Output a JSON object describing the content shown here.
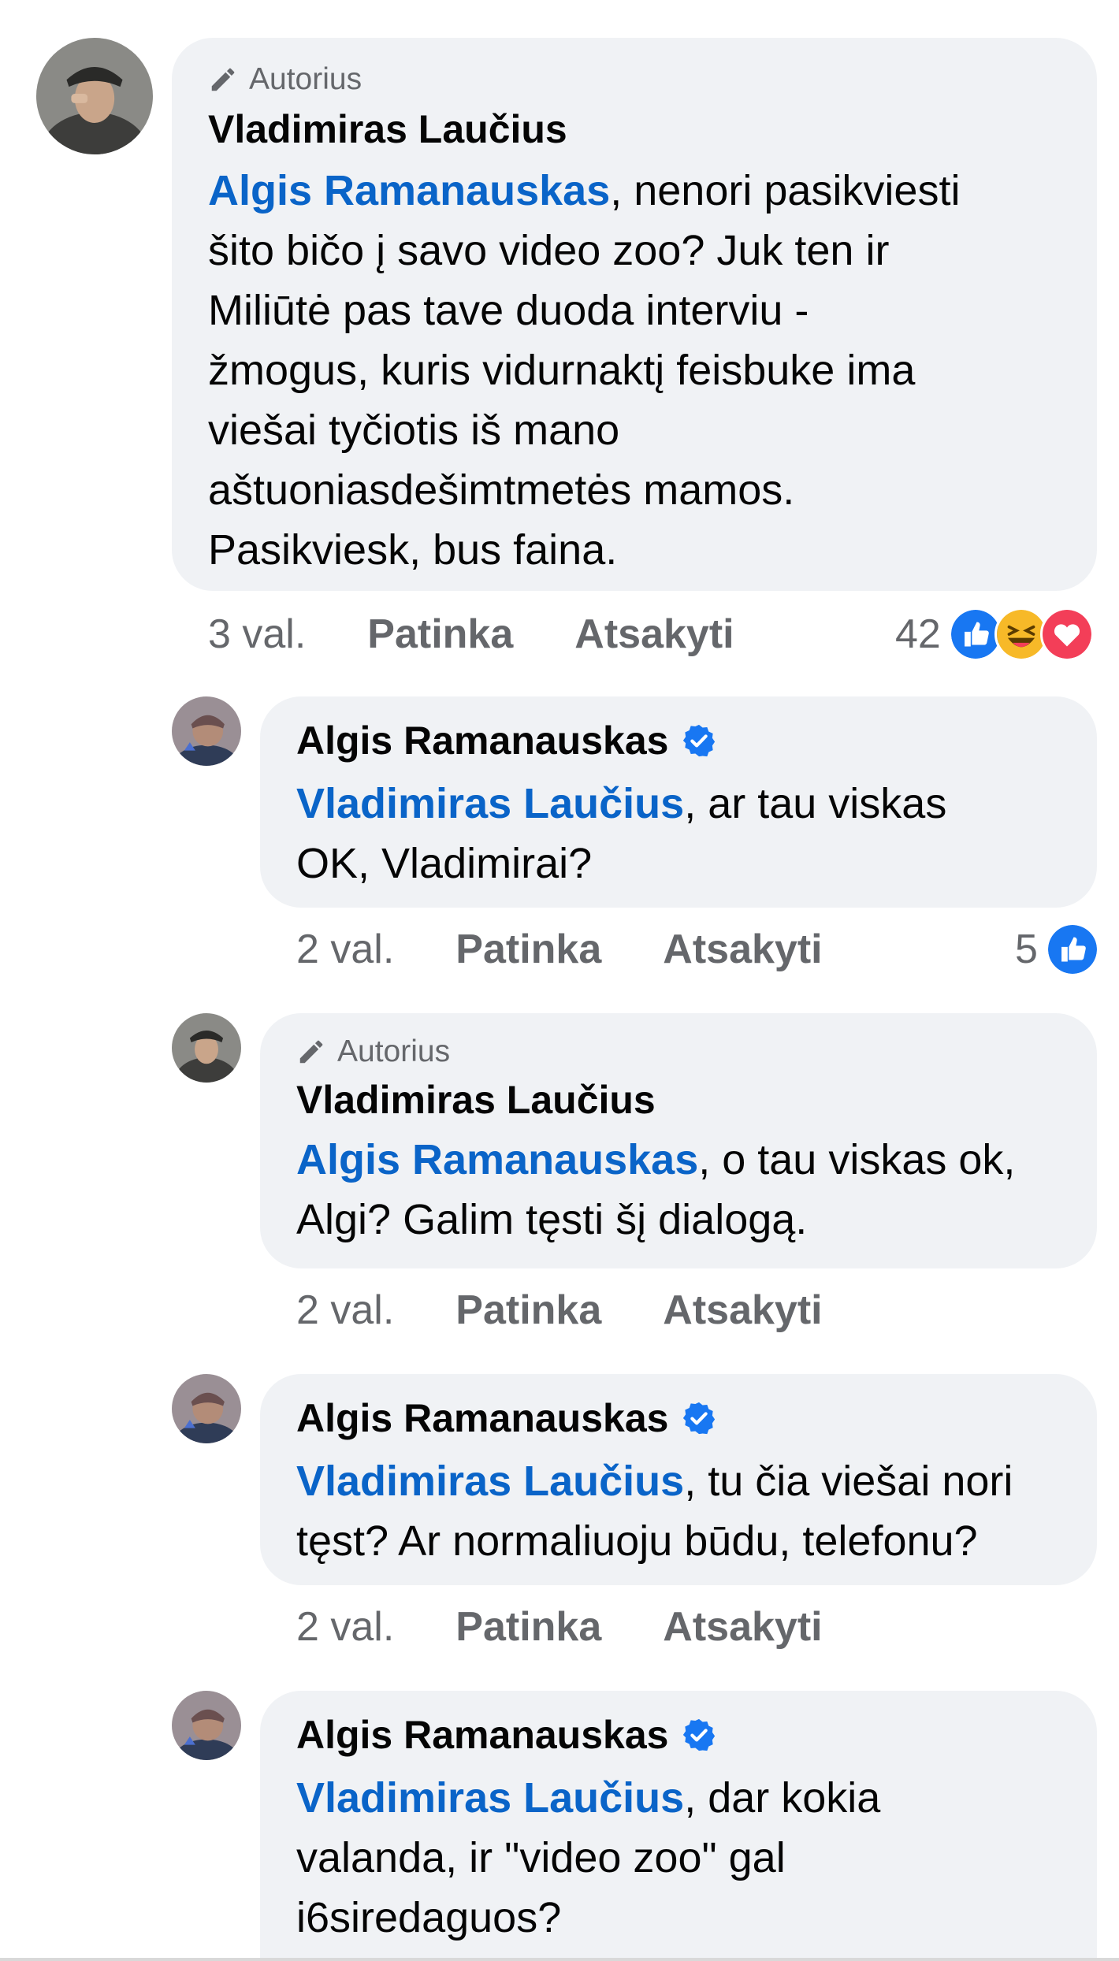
{
  "comments": [
    {
      "author_badge": "Autorius",
      "name": "Vladimiras Laučius",
      "verified": false,
      "mention": "Algis Ramanauskas",
      "lines": [
        ", nenori pasikviesti",
        "šito bičo į savo video zoo? Juk ten ir",
        "Miliūtė pas tave duoda interviu -",
        "žmogus, kuris vidurnaktį feisbuke ima",
        "viešai tyčiotis iš mano",
        "aštuoniasdešimtmetės mamos.",
        "Pasikviesk, bus faina."
      ],
      "time": "3 val.",
      "like_label": "Patinka",
      "reply_label": "Atsakyti",
      "reaction_count": "42",
      "reactions": [
        "like-icon",
        "haha-icon",
        "love-icon"
      ]
    },
    {
      "author_badge": "",
      "name": "Algis Ramanauskas",
      "verified": true,
      "mention": "Vladimiras Laučius",
      "lines": [
        ", ar tau viskas",
        "OK, Vladimirai?"
      ],
      "time": "2 val.",
      "like_label": "Patinka",
      "reply_label": "Atsakyti",
      "reaction_count": "5",
      "reactions": [
        "like-icon"
      ]
    },
    {
      "author_badge": "Autorius",
      "name": "Vladimiras Laučius",
      "verified": false,
      "mention": "Algis Ramanauskas",
      "lines": [
        ", o tau viskas ok,",
        "Algi? Galim tęsti šį dialogą."
      ],
      "time": "2 val.",
      "like_label": "Patinka",
      "reply_label": "Atsakyti",
      "reaction_count": "",
      "reactions": []
    },
    {
      "author_badge": "",
      "name": "Algis Ramanauskas",
      "verified": true,
      "mention": "Vladimiras Laučius",
      "lines": [
        ", tu čia viešai nori",
        "tęst? Ar normaliuoju būdu, telefonu?"
      ],
      "time": "2 val.",
      "like_label": "Patinka",
      "reply_label": "Atsakyti",
      "reaction_count": "",
      "reactions": []
    },
    {
      "author_badge": "",
      "name": "Algis Ramanauskas",
      "verified": true,
      "mention": "Vladimiras Laučius",
      "lines": [
        ", dar kokia",
        "valanda, ir \"video zoo\" gal",
        "i6siredaguos?"
      ],
      "time": "",
      "like_label": "",
      "reply_label": "",
      "reaction_count": "",
      "reactions": []
    }
  ],
  "colors": {
    "bubble": "#f0f2f5",
    "mention": "#0a64c8",
    "meta": "#65676b",
    "like_blue": "#1877f2",
    "haha_yellow": "#f7b928",
    "love_red": "#f33e58"
  }
}
